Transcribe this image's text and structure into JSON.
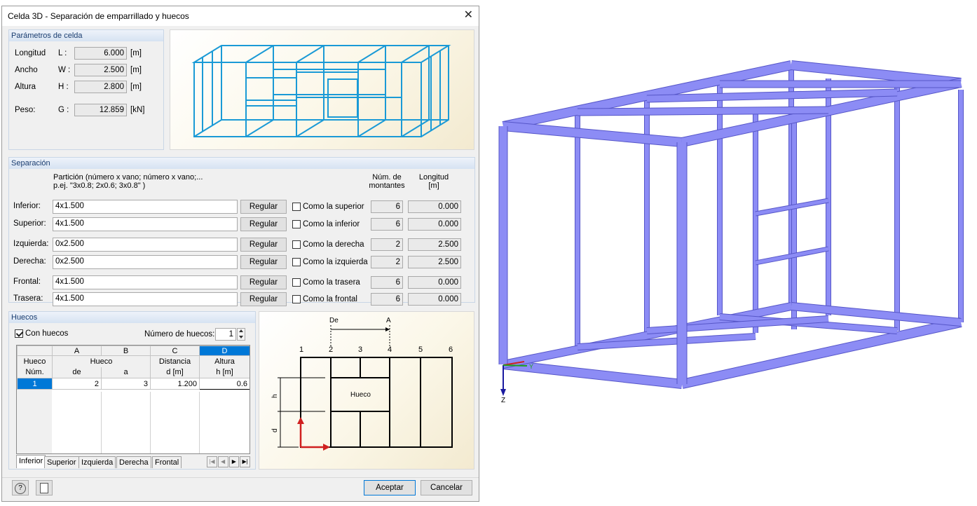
{
  "dialog": {
    "title": "Celda 3D - Separación de emparrillado y huecos",
    "close_glyph": "✕"
  },
  "params": {
    "header": "Parámetros de celda",
    "rows": [
      {
        "name": "Longitud",
        "sym": "L :",
        "value": "6.000",
        "unit": "[m]"
      },
      {
        "name": "Ancho",
        "sym": "W :",
        "value": "2.500",
        "unit": "[m]"
      },
      {
        "name": "Altura",
        "sym": "H :",
        "value": "2.800",
        "unit": "[m]"
      },
      {
        "name": "Peso:",
        "sym": "G :",
        "value": "12.859",
        "unit": "[kN]"
      }
    ]
  },
  "separation": {
    "header": "Separación",
    "partition_hint_line1": "Partición (número x vano; número x vano;...",
    "partition_hint_line2": "p.ej.  \"3x0.8; 2x0.6; 3x0.8\" )",
    "col_count_line1": "Núm. de",
    "col_count_line2": "montantes",
    "col_length_line1": "Longitud",
    "col_length_line2": "[m]",
    "button_label": "Regular",
    "rows": [
      {
        "label": "Inferior:",
        "value": "4x1.500",
        "check": "Como la superior",
        "count": "6",
        "length": "0.000"
      },
      {
        "label": "Superior:",
        "value": "4x1.500",
        "check": "Como la inferior",
        "count": "6",
        "length": "0.000"
      },
      {
        "label": "Izquierda:",
        "value": "0x2.500",
        "check": "Como la derecha",
        "count": "2",
        "length": "2.500"
      },
      {
        "label": "Derecha:",
        "value": "0x2.500",
        "check": "Como la izquierda",
        "count": "2",
        "length": "2.500"
      },
      {
        "label": "Frontal:",
        "value": "4x1.500",
        "check": "Como la trasera",
        "count": "6",
        "length": "0.000"
      },
      {
        "label": "Trasera:",
        "value": "4x1.500",
        "check": "Como la frontal",
        "count": "6",
        "length": "0.000"
      }
    ]
  },
  "openings": {
    "header": "Huecos",
    "with_openings_label": "Con huecos",
    "count_label": "Número de huecos:",
    "count_value": "1",
    "table": {
      "col_letters": [
        "A",
        "B",
        "C",
        "D"
      ],
      "h_num_1": "Hueco",
      "h_num_2": "Núm.",
      "h_hueco": "Hueco",
      "h_de": "de",
      "h_a": "a",
      "h_dist_1": "Distancia",
      "h_dist_2": "d [m]",
      "h_alt_1": "Altura",
      "h_alt_2": "h [m]",
      "row": {
        "num": "1",
        "de": "2",
        "a": "3",
        "dist": "1.200",
        "alt": "0.6"
      }
    },
    "tabs": [
      "Inferior",
      "Superior",
      "Izquierda",
      "Derecha",
      "Frontal"
    ],
    "nav_glyphs": [
      "|◀",
      "◀",
      "▶",
      "▶|"
    ]
  },
  "diagram": {
    "label_de": "De",
    "label_a": "A",
    "numbers": [
      "1",
      "2",
      "3",
      "4",
      "5",
      "6"
    ],
    "hueco": "Hueco",
    "h": "h",
    "d": "d"
  },
  "footer": {
    "accept": "Aceptar",
    "cancel": "Cancelar"
  },
  "viewport": {
    "axis_z": "Z",
    "axis_y": "Y",
    "beam_color": "#8c8cf5",
    "beam_edge": "#5656c8"
  }
}
